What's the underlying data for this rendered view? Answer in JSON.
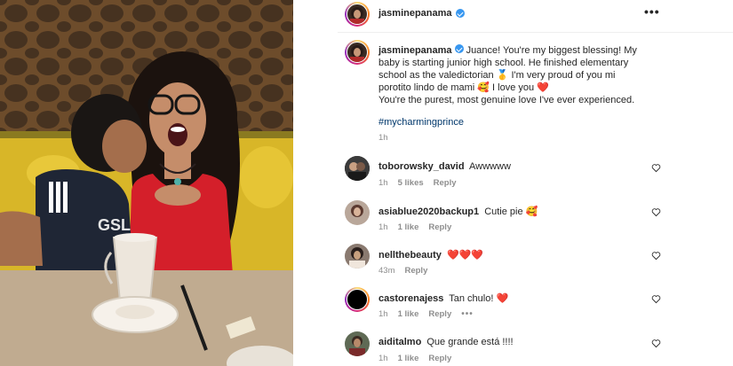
{
  "post": {
    "author": "jasminepanama",
    "more_icon": "more-horizontal-icon",
    "caption_text": "Juance! You're my biggest blessing! My baby is starting junior high school. He finished elementary school as the valedictorian 🥇 I'm very proud of you mi porotito lindo de mami 🥰 I love you ❤️",
    "caption_text2": "You're the purest, most genuine love I've ever experienced.",
    "hashtag": "#mycharmingprince",
    "time": "1h"
  },
  "comments": [
    {
      "user": "toborowsky_david",
      "text": "Awwwww",
      "time": "1h",
      "likes": "5 likes",
      "reply": "Reply"
    },
    {
      "user": "asiablue2020backup1",
      "text": "Cutie pie 🥰",
      "time": "1h",
      "likes": "1 like",
      "reply": "Reply"
    },
    {
      "user": "nellthebeauty",
      "text": "❤️❤️❤️",
      "time": "43m",
      "likes": "",
      "reply": "Reply"
    },
    {
      "user": "castorenajess",
      "text": "Tan chulo! ❤️",
      "time": "1h",
      "likes": "1 like",
      "reply": "Reply",
      "more": "•••"
    },
    {
      "user": "aiditalmo",
      "text": "Que grande está !!!!",
      "time": "1h",
      "likes": "1 like",
      "reply": "Reply"
    }
  ],
  "colors": {
    "verified": "#3897f0",
    "hashtag": "#00376b",
    "muted": "#8e8e8e",
    "text": "#262626"
  }
}
